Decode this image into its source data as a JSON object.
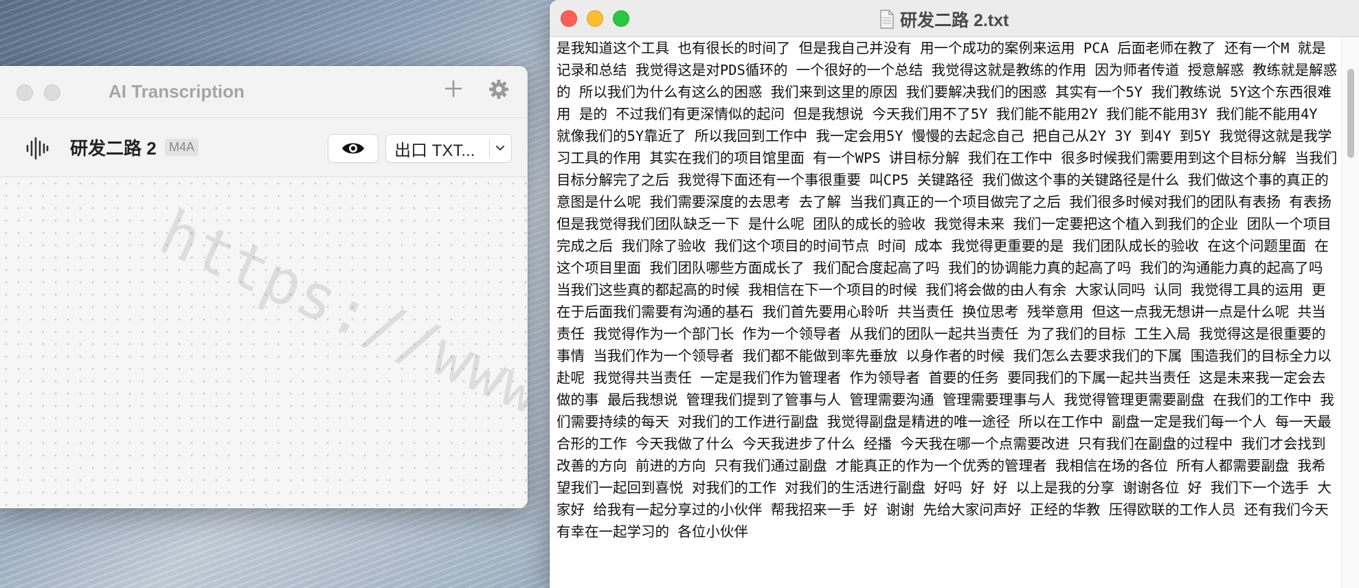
{
  "transcription_window": {
    "title": "AI Transcription",
    "add_icon": "plus-icon",
    "settings_icon": "gear-icon",
    "file": {
      "name": "研发二路 2",
      "format": "M4A",
      "icon": "waveform-icon",
      "preview_icon": "eye-icon",
      "export_label": "出口 TXT..."
    },
    "watermark": "https://www"
  },
  "text_window": {
    "title": "研发二路 2.txt",
    "content": "是我知道这个工具 也有很长的时间了 但是我自己并没有 用一个成功的案例来运用 PCA 后面老师在教了 还有一个M 就是记录和总结 我觉得这是对PDS循环的 一个很好的一个总结 我觉得这就是教练的作用 因为师者传道 授意解惑 教练就是解惑的 所以我们为什么有这么的困惑 我们来到这里的原因 我们要解决我们的困惑 其实有一个5Y 我们教练说 5Y这个东西很难用 是的 不过我们有更深情似的起问 但是我想说 今天我们用不了5Y 我们能不能用2Y 我们能不能用3Y 我们能不能用4Y 就像我们的5Y靠近了 所以我回到工作中 我一定会用5Y 慢慢的去起念自己 把自己从2Y 3Y 到4Y 到5Y 我觉得这就是我学习工具的作用 其实在我们的项目馆里面 有一个WPS 讲目标分解 我们在工作中 很多时候我们需要用到这个目标分解 当我们目标分解完了之后 我觉得下面还有一个事很重要 叫CP5 关键路径 我们做这个事的关键路径是什么 我们做这个事的真正的意图是什么呢 我们需要深度的去思考 去了解 当我们真正的一个项目做完了之后 我们很多时候对我们的团队有表扬 有表扬 但是我觉得我们团队缺乏一下 是什么呢 团队的成长的验收 我觉得未来 我们一定要把这个植入到我们的企业 团队一个项目完成之后 我们除了验收 我们这个项目的时间节点 时间 成本 我觉得更重要的是 我们团队成长的验收 在这个问题里面 在这个项目里面 我们团队哪些方面成长了 我们配合度起高了吗 我们的协调能力真的起高了吗 我们的沟通能力真的起高了吗 当我们这些真的都起高的时候 我相信在下一个项目的时候 我们将会做的由人有余 大家认同吗 认同 我觉得工具的运用 更在于后面我们需要有沟通的基石 我们首先要用心聆听 共当责任 换位思考 残举意用 但这一点我无想讲一点是什么呢 共当责任 我觉得作为一个部门长 作为一个领导者 从我们的团队一起共当责任 为了我们的目标 工生入局 我觉得这是很重要的事情 当我们作为一个领导者 我们都不能做到率先垂放 以身作者的时候 我们怎么去要求我们的下属 围造我们的目标全力以赴呢 我觉得共当责任 一定是我们作为管理者 作为领导者 首要的任务 要同我们的下属一起共当责任 这是未来我一定会去做的事 最后我想说 管理我们提到了管事与人 管理需要沟通 管理需要理事与人 我觉得管理更需要副盘 在我们的工作中 我们需要持续的每天 对我们的工作进行副盘 我觉得副盘是精进的唯一途径 所以在工作中 副盘一定是我们每一个人 每一天最合形的工作 今天我做了什么 今天我进步了什么 经播 今天我在哪一个点需要改进 只有我们在副盘的过程中 我们才会找到改善的方向 前进的方向 只有我们通过副盘 才能真正的作为一个优秀的管理者 我相信在场的各位 所有人都需要副盘 我希望我们一起回到喜悦 对我们的工作 对我们的生活进行副盘 好吗 好 好 以上是我的分享 谢谢各位 好 我们下一个选手 大家好 给我有一起分享过的小伙伴 帮我招来一手 好 谢谢 先给大家问声好 正经的华教 压得欧联的工作人员 还有我们今天有幸在一起学习的 各位小伙伴"
  }
}
